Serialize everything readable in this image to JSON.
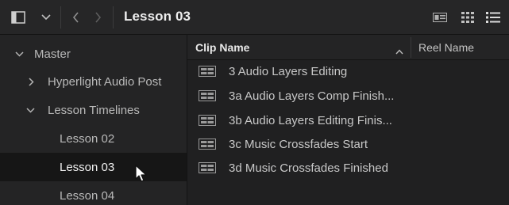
{
  "toolbar": {
    "title": "Lesson 03",
    "icons": [
      "sidebar-toggle-icon",
      "chevron-down-icon",
      "back-arrow-icon",
      "forward-arrow-icon",
      "metadata-view-icon",
      "thumbnail-view-icon",
      "list-view-icon"
    ]
  },
  "sidebar": {
    "items": [
      {
        "label": "Master",
        "expanded": true
      },
      {
        "label": "Hyperlight Audio Post",
        "expanded": false
      },
      {
        "label": "Lesson Timelines",
        "expanded": true
      },
      {
        "label": "Lesson 02"
      },
      {
        "label": "Lesson 03",
        "selected": true
      },
      {
        "label": "Lesson 04"
      }
    ]
  },
  "table": {
    "columns": {
      "clip_name": "Clip Name",
      "reel_name": "Reel Name"
    },
    "sort_icon": "sort-ascending-icon",
    "rows": [
      {
        "clip_name": "3 Audio Layers Editing"
      },
      {
        "clip_name": "3a Audio Layers Comp Finish..."
      },
      {
        "clip_name": "3b Audio Layers Editing Finis..."
      },
      {
        "clip_name": "3c Music Crossfades Start"
      },
      {
        "clip_name": "3d Music Crossfades Finished"
      }
    ]
  },
  "colors": {
    "background": "#1e1e1f",
    "selected_row": "#161616",
    "text": "#c9c9c9"
  }
}
